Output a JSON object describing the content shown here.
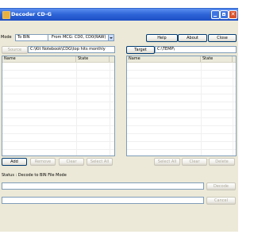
{
  "window": {
    "title": "Decoder CD-G",
    "controls": {
      "minimize": "",
      "maximize": "",
      "close": "✕"
    }
  },
  "mode": {
    "label": "Mode",
    "value": "To BIN",
    "from_value": "From MCG: CD0, CD0(RAW)"
  },
  "buttons": {
    "help": "Help",
    "about": "About",
    "close": "Close"
  },
  "source": {
    "button": "Source",
    "path": "C:\\Kit Notebook\\CDG\\top hits monthly",
    "columns": [
      "Name",
      "State"
    ],
    "actions": [
      {
        "label": "Add",
        "enabled": true
      },
      {
        "label": "Remove",
        "enabled": false
      },
      {
        "label": "Clear",
        "enabled": false
      },
      {
        "label": "Select All",
        "enabled": false
      }
    ]
  },
  "target": {
    "button": "Target",
    "path": "C:\\TEMP\\",
    "columns": [
      "Name",
      "State"
    ],
    "actions": [
      {
        "label": "Select All",
        "enabled": false
      },
      {
        "label": "Clear",
        "enabled": false
      },
      {
        "label": "Delete",
        "enabled": false
      }
    ]
  },
  "status": {
    "text": "Status : Decode to BIN File Mode",
    "decode_button": "Decode",
    "cancel_button": "Cancel"
  }
}
